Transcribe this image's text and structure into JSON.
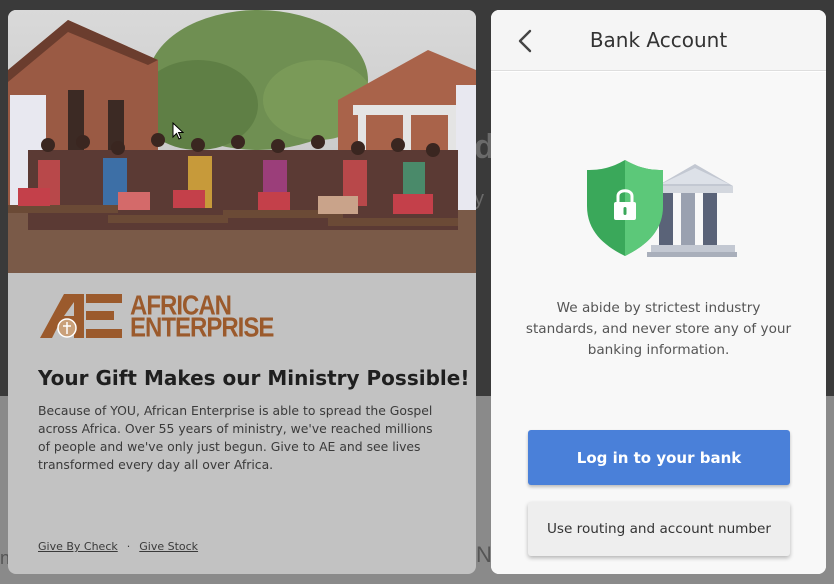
{
  "campaign": {
    "logo_line1": "AFRICAN",
    "logo_line2": "ENTERPRISE",
    "headline": "Your Gift Makes our Ministry Possible!",
    "body": "Because of YOU, African Enterprise is able to spread the Gospel across Africa. Over 55 years of ministry, we've reached millions of people and we've only just begun. Give to AE and see lives transformed every day all over Africa.",
    "links": {
      "give_by_check": "Give By Check",
      "separator": "·",
      "give_stock": "Give Stock"
    },
    "brand_color": "#9b5a2c"
  },
  "bank_panel": {
    "title": "Bank Account",
    "back_icon": "chevron-left-icon",
    "illustration_icons": [
      "shield-lock-icon",
      "bank-building-icon"
    ],
    "security_text": "We abide by strictest industry standards, and never store any of your banking information.",
    "primary_button": "Log in to your bank",
    "secondary_button": "Use routing and account number",
    "colors": {
      "primary": "#4a80d9",
      "shield": "#4dbb6c"
    }
  },
  "background_fragments": {
    "frag1": "d",
    "frag2": "y",
    "frag3": "N",
    "frag4": "n",
    "frag5": "("
  }
}
